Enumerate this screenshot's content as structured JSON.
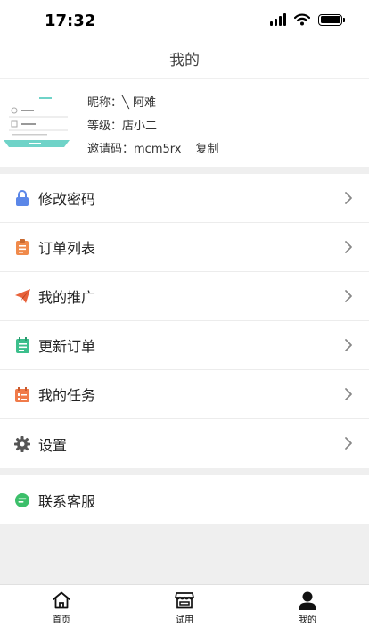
{
  "status_bar": {
    "time": "17:32"
  },
  "nav": {
    "title": "我的"
  },
  "profile": {
    "nickname_label": "昵称：",
    "nickname": "╲ 阿难",
    "level_label": "等级：",
    "level": "店小二",
    "invite_label": "邀请码：",
    "invite_code": "mcm5rx",
    "copy_label": "复制"
  },
  "menu": {
    "items": [
      {
        "label": "修改密码",
        "icon": "lock-icon",
        "color": "#5b87e8"
      },
      {
        "label": "订单列表",
        "icon": "clipboard-icon",
        "color": "#f08a4b"
      },
      {
        "label": "我的推广",
        "icon": "paper-plane-icon",
        "color": "#e8623a"
      },
      {
        "label": "更新订单",
        "icon": "notepad-icon",
        "color": "#3cbf8c"
      },
      {
        "label": "我的任务",
        "icon": "task-calendar-icon",
        "color": "#f07b4a"
      },
      {
        "label": "设置",
        "icon": "gear-icon",
        "color": "#555555"
      }
    ],
    "service": {
      "label": "联系客服",
      "icon": "chat-icon",
      "color": "#3cbf6a"
    }
  },
  "tabs": [
    {
      "label": "首页",
      "icon": "home-icon"
    },
    {
      "label": "试用",
      "icon": "store-icon"
    },
    {
      "label": "我的",
      "icon": "person-icon",
      "active": true
    }
  ]
}
